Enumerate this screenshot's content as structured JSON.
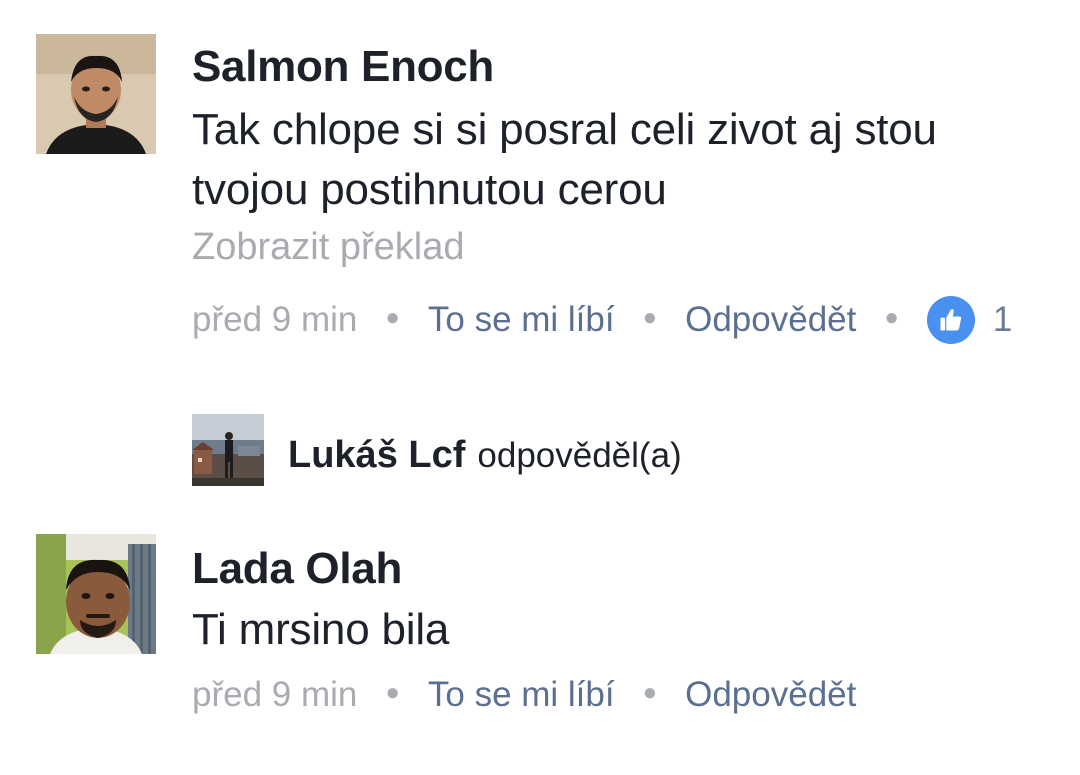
{
  "comments": [
    {
      "author": "Salmon Enoch",
      "text": "Tak chlope si si posral celi zivot aj stou tvojou postihnutou cerou",
      "translate_label": "Zobrazit překlad",
      "time": "před 9 min",
      "like_label": "To se mi líbí",
      "reply_label": "Odpovědět",
      "reaction_icon": "thumbs-up-icon",
      "reaction_count": "1"
    },
    {
      "author": "Lada Olah",
      "text": "Ti mrsino bila",
      "time": "před 9 min",
      "like_label": "To se mi líbí",
      "reply_label": "Odpovědět"
    }
  ],
  "reply_summary": {
    "author": "Lukáš Lcf",
    "action": "odpověděl(a)"
  },
  "colors": {
    "author_text": "#1d2129",
    "muted_text": "#a8abb0",
    "link_text": "#5b6f91",
    "like_badge": "#4a90f0"
  }
}
